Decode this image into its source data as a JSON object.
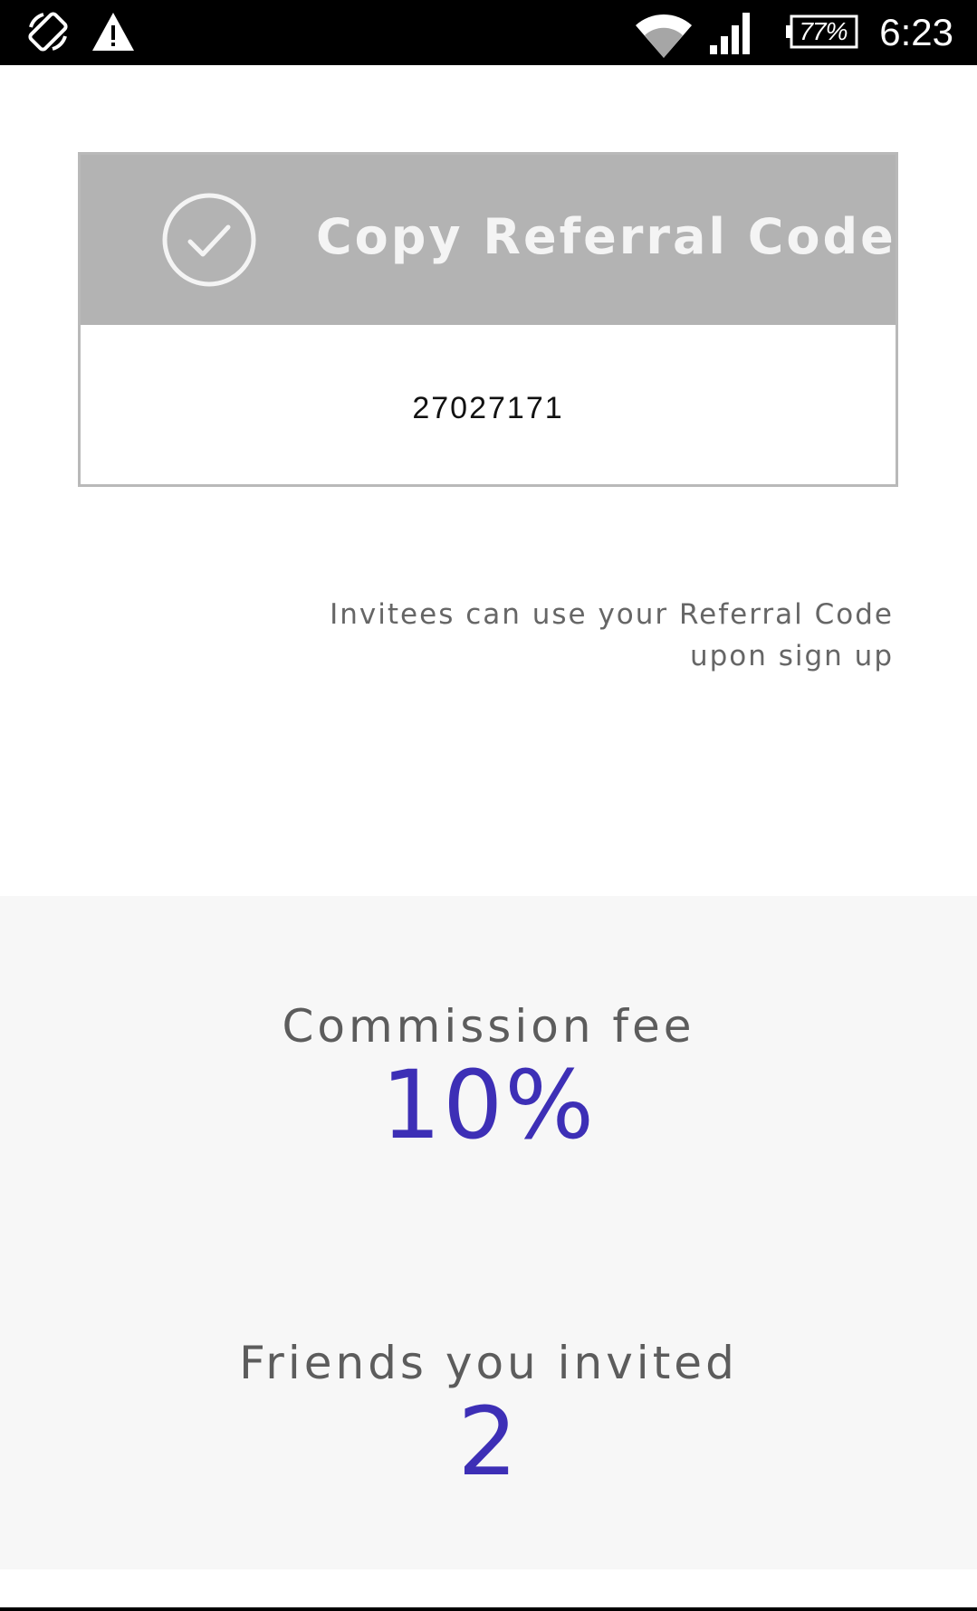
{
  "status_bar": {
    "battery": "77%",
    "time": "6:23",
    "icons": [
      "screen-rotation-icon",
      "warning-icon",
      "wifi-icon",
      "cell-signal-icon",
      "battery-icon"
    ]
  },
  "referral": {
    "copy_button_label": "Copy Referral Code",
    "code": "27027171",
    "hint_line1": "Invitees can use your Referral Code",
    "hint_line2": "upon sign up"
  },
  "stats": {
    "commission_label": "Commission fee",
    "commission_value": "10%",
    "friends_label": "Friends you invited",
    "friends_value": "2"
  },
  "colors": {
    "accent": "#3d2fb6",
    "button_bg": "#b3b3b3",
    "panel_bg": "#f7f7f7"
  }
}
